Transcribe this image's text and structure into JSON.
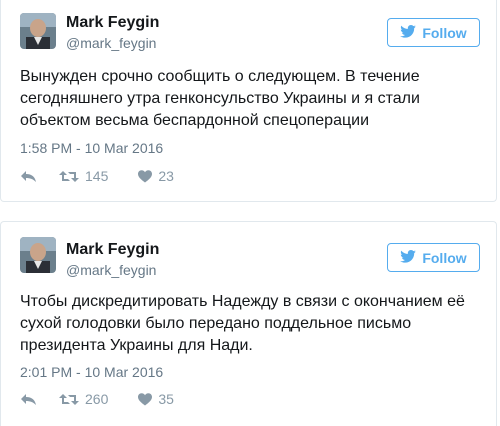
{
  "tweets": [
    {
      "author_name": "Mark Feygin",
      "author_handle": "@mark_feygin",
      "follow_label": "Follow",
      "text": "Вынужден срочно сообщить о следующем. В течение сегодняшнего утра генконсульство Украины и я стали объектом весьма беспардонной спецоперации",
      "timestamp": "1:58 PM - 10 Mar 2016",
      "retweets": "145",
      "likes": "23"
    },
    {
      "author_name": "Mark Feygin",
      "author_handle": "@mark_feygin",
      "follow_label": "Follow",
      "text": "Чтобы дискредитировать Надежду в связи с окончанием её сухой голодовки было передано поддельное письмо президента Украины для Нади.",
      "timestamp": "2:01 PM - 10 Mar 2016",
      "retweets": "260",
      "likes": "35"
    }
  ],
  "colors": {
    "accent": "#55acee",
    "muted": "#657786",
    "icon": "#8899a6",
    "border": "#e1e8ed"
  },
  "icons": {
    "follow": "twitter-bird-icon",
    "reply": "reply-icon",
    "retweet": "retweet-icon",
    "like": "heart-icon"
  }
}
